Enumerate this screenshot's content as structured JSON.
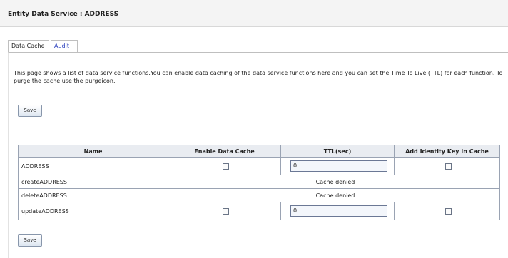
{
  "header": {
    "title": "Entity Data Service : ADDRESS"
  },
  "tabs": [
    {
      "label": "Data Cache",
      "active": true
    },
    {
      "label": "Audit",
      "active": false
    }
  ],
  "description": "This page shows a list of data service functions.You can enable data caching of the data service functions here and you can set the Time To Live (TTL) for each function. To purge the cache use the purgeicon.",
  "buttons": {
    "save_top": "Save",
    "save_bottom": "Save"
  },
  "table": {
    "columns": [
      "Name",
      "Enable Data Cache",
      "TTL(sec)",
      "Add Identity Key In Cache"
    ],
    "rows": [
      {
        "name": "ADDRESS",
        "type": "editable",
        "enable_cache": false,
        "ttl": "0",
        "add_identity_key": false
      },
      {
        "name": "createADDRESS",
        "type": "denied",
        "message": "Cache denied"
      },
      {
        "name": "deleteADDRESS",
        "type": "denied",
        "message": "Cache denied"
      },
      {
        "name": "updateADDRESS",
        "type": "editable",
        "enable_cache": false,
        "ttl": "0",
        "add_identity_key": false
      }
    ]
  },
  "colors": {
    "link_blue": "#2a3fbd",
    "header_bg": "#e9ecf1",
    "input_bg": "#f3f6fb"
  }
}
